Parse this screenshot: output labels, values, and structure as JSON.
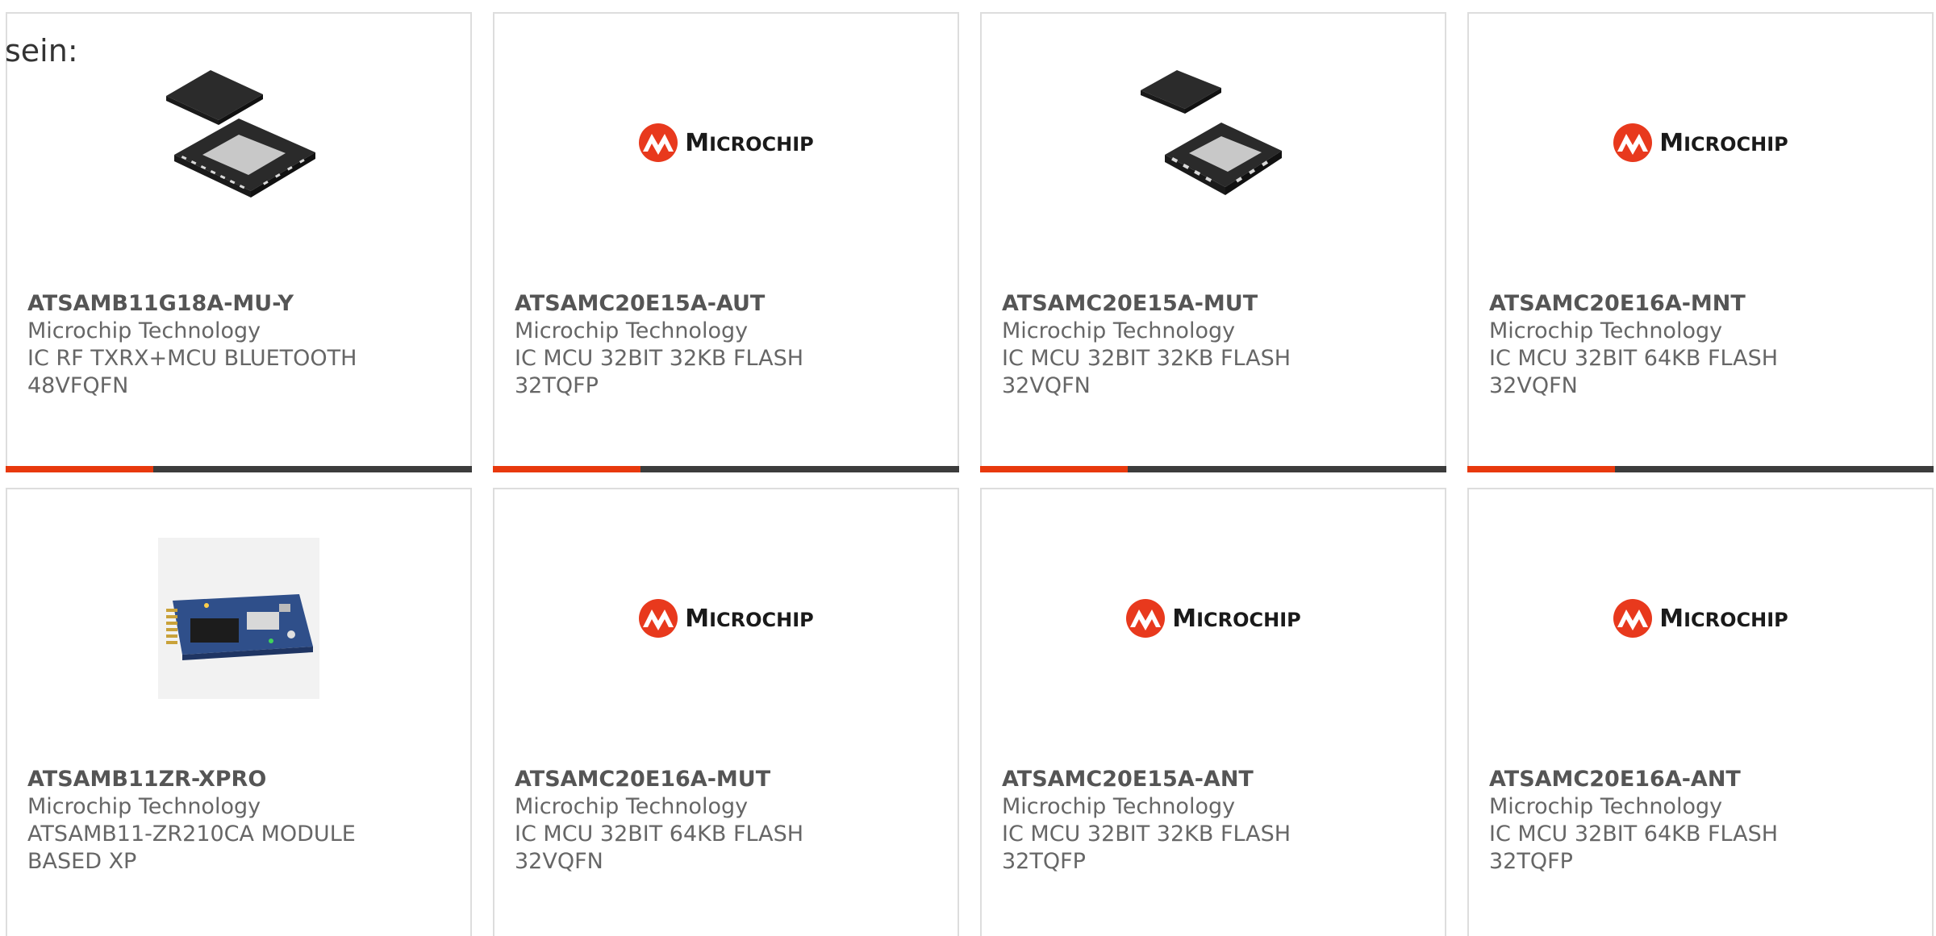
{
  "intro_text": "sein:",
  "colors": {
    "accent": "#e8390d",
    "bar": "#3c3c3c",
    "border": "#dddddd",
    "text": "#666666"
  },
  "products": [
    {
      "part_number": "ATSAMB11G18A-MU-Y",
      "manufacturer": "Microchip Technology",
      "desc_line1": "IC RF TXRX+MCU BLUETOOTH",
      "desc_line2": "48VFQFN",
      "image": "qfn-chip-48"
    },
    {
      "part_number": "ATSAMC20E15A-AUT",
      "manufacturer": "Microchip Technology",
      "desc_line1": "IC MCU 32BIT 32KB FLASH",
      "desc_line2": "32TQFP",
      "image": "microchip-logo"
    },
    {
      "part_number": "ATSAMC20E15A-MUT",
      "manufacturer": "Microchip Technology",
      "desc_line1": "IC MCU 32BIT 32KB FLASH",
      "desc_line2": "32VQFN",
      "image": "qfn-chip-32"
    },
    {
      "part_number": "ATSAMC20E16A-MNT",
      "manufacturer": "Microchip Technology",
      "desc_line1": "IC MCU 32BIT 64KB FLASH",
      "desc_line2": "32VQFN",
      "image": "microchip-logo"
    },
    {
      "part_number": "ATSAMB11ZR-XPRO",
      "manufacturer": "Microchip Technology",
      "desc_line1": "ATSAMB11-ZR210CA MODULE",
      "desc_line2": "BASED XP",
      "image": "dev-board"
    },
    {
      "part_number": "ATSAMC20E16A-MUT",
      "manufacturer": "Microchip Technology",
      "desc_line1": "IC MCU 32BIT 64KB FLASH",
      "desc_line2": "32VQFN",
      "image": "microchip-logo"
    },
    {
      "part_number": "ATSAMC20E15A-ANT",
      "manufacturer": "Microchip Technology",
      "desc_line1": "IC MCU 32BIT 32KB FLASH",
      "desc_line2": "32TQFP",
      "image": "microchip-logo"
    },
    {
      "part_number": "ATSAMC20E16A-ANT",
      "manufacturer": "Microchip Technology",
      "desc_line1": "IC MCU 32BIT 64KB FLASH",
      "desc_line2": "32TQFP",
      "image": "microchip-logo"
    }
  ],
  "logo": {
    "word_big_m": "M",
    "word_rest": "ICROCHIP"
  }
}
